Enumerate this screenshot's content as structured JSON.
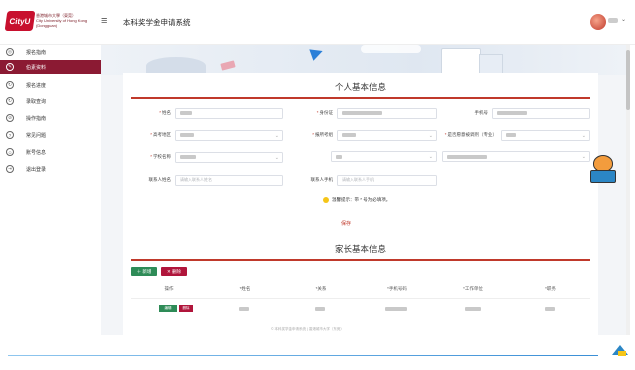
{
  "header": {
    "logo_mark": "CityU",
    "logo_text_zh": "香港城市大學（東莞）",
    "logo_text_en": "City University of Hong Kong (Dongguan)",
    "menu_toggle": "≡",
    "system_title": "本科奖学金申请系统",
    "user_caret": "⌄"
  },
  "sidebar": {
    "items": [
      {
        "label": "报名指南",
        "icon": "compass-icon",
        "glyph": "◎",
        "active": false
      },
      {
        "label": "伯素资料",
        "icon": "edit-icon",
        "glyph": "✎",
        "active": true
      },
      {
        "label": "报名进度",
        "icon": "progress-icon",
        "glyph": "↻",
        "active": false
      },
      {
        "label": "录取查询",
        "icon": "search-icon",
        "glyph": "↻",
        "active": false
      },
      {
        "label": "操作指南",
        "icon": "guide-icon",
        "glyph": "⊘",
        "active": false
      },
      {
        "label": "常见问题",
        "icon": "question-icon",
        "glyph": "?",
        "active": false
      },
      {
        "label": "账号信息",
        "icon": "user-icon",
        "glyph": "☺",
        "active": false
      },
      {
        "label": "退出登录",
        "icon": "logout-icon",
        "glyph": "⇥",
        "active": false
      }
    ]
  },
  "personal": {
    "title": "个人基本信息",
    "name_label": "姓名",
    "id_label": "身份证",
    "phone_label": "手机号",
    "exam_region_label": "高考地区",
    "exam_subject_label": "报所考组",
    "pref_label": "是否愿意被调剂（专业）",
    "school_label": "学校名称",
    "contact_name_label": "联系人姓名",
    "contact_name_placeholder": "请输入联系人姓名",
    "contact_phone_label": "联系人手机",
    "contact_phone_placeholder": "请输入联系人手机",
    "tip": "温馨提示：带 * 号为必填项。",
    "save_label": "保存"
  },
  "family": {
    "title": "家长基本信息",
    "add_label": "＋ 新增",
    "delete_label": "✕ 删除",
    "columns": [
      "操作",
      "*姓名",
      "*关系",
      "*手机号码",
      "*工作单位",
      "*职务"
    ],
    "row_edit_label": "编辑",
    "row_delete_label": "删除"
  },
  "footer": {
    "note": "© 本科奖学金申请系统 | 香港城市大学（东莞）"
  },
  "colors": {
    "brand": "#8b1a33",
    "accent": "#c0392b",
    "success": "#2e8b57"
  }
}
